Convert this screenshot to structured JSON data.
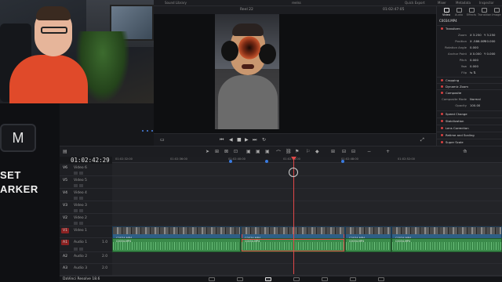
{
  "topbar": {
    "left": "Sound Library",
    "project": "reelss",
    "right_items": [
      "Quick Export",
      "Mixer",
      "Metadata",
      "Inspector"
    ]
  },
  "viewer": {
    "timeline_name": "Reel 22",
    "timecode": "01:02:47:05",
    "clip_name": "C0034.MP4"
  },
  "brand": {
    "key": "M",
    "line1": "SET",
    "line2": "ARKER"
  },
  "inspector": {
    "tabs": [
      "Video",
      "Audio",
      "Effects",
      "Transition",
      "Image"
    ],
    "clip": "C0034.MP4",
    "sections": [
      {
        "title": "Transform"
      },
      {
        "title": "Cropping"
      },
      {
        "title": "Dynamic Zoom"
      },
      {
        "title": "Composite"
      },
      {
        "title": "Speed Change"
      },
      {
        "title": "Stabilization"
      },
      {
        "title": "Lens Correction"
      },
      {
        "title": "Retime and Scaling"
      },
      {
        "title": "Super Scale"
      }
    ],
    "transform_rows": [
      {
        "label": "Zoom",
        "x": "X 3.250",
        "y": "Y 3.250"
      },
      {
        "label": "Position",
        "x": "X -586.000",
        "y": "Y 0.000"
      },
      {
        "label": "Rotation Angle",
        "x": "0.000",
        "y": ""
      },
      {
        "label": "Anchor Point",
        "x": "X 0.000",
        "y": "Y 0.000"
      },
      {
        "label": "Pitch",
        "x": "0.000",
        "y": ""
      },
      {
        "label": "Yaw",
        "x": "0.000",
        "y": ""
      },
      {
        "label": "Flip",
        "x": "",
        "y": ""
      }
    ],
    "composite_rows": [
      {
        "label": "Composite Mode",
        "x": "Normal"
      },
      {
        "label": "Opacity",
        "x": "100.00"
      }
    ]
  },
  "timeline": {
    "timecode": "01:02:42:29",
    "ruler_ticks": [
      "01:02:32:00",
      "01:02:36:00",
      "01:02:40:00",
      "01:02:44:00",
      "01:02:48:00",
      "01:02:52:00"
    ],
    "tracks": [
      {
        "id": "V6",
        "name": "Video 6"
      },
      {
        "id": "V5",
        "name": "Video 5"
      },
      {
        "id": "V4",
        "name": "Video 4"
      },
      {
        "id": "V3",
        "name": "Video 3"
      },
      {
        "id": "V2",
        "name": "Video 2"
      },
      {
        "id": "V1",
        "name": "Video 1"
      },
      {
        "id": "A1",
        "name": "Audio 1",
        "level": "1.0"
      },
      {
        "id": "A2",
        "name": "Audio 2",
        "level": "2.0"
      },
      {
        "id": "A3",
        "name": "Audio 3",
        "level": "2.0"
      }
    ],
    "clips": {
      "video": [
        "C0034.MP4",
        "C0034.MP4",
        "C0034.MP4",
        "C0034.MP4"
      ],
      "audio": [
        "C0034.MP4",
        "C0034.MP4",
        "C0034.MP4",
        "C0034.MP4"
      ]
    }
  },
  "bottombar": {
    "app_name": "DaVinci Resolve 18.6"
  },
  "colors": {
    "accent": "#e04848",
    "video_clip": "#2e5f86",
    "audio_clip": "#3a8a4a",
    "marker": "#3a7be0"
  }
}
